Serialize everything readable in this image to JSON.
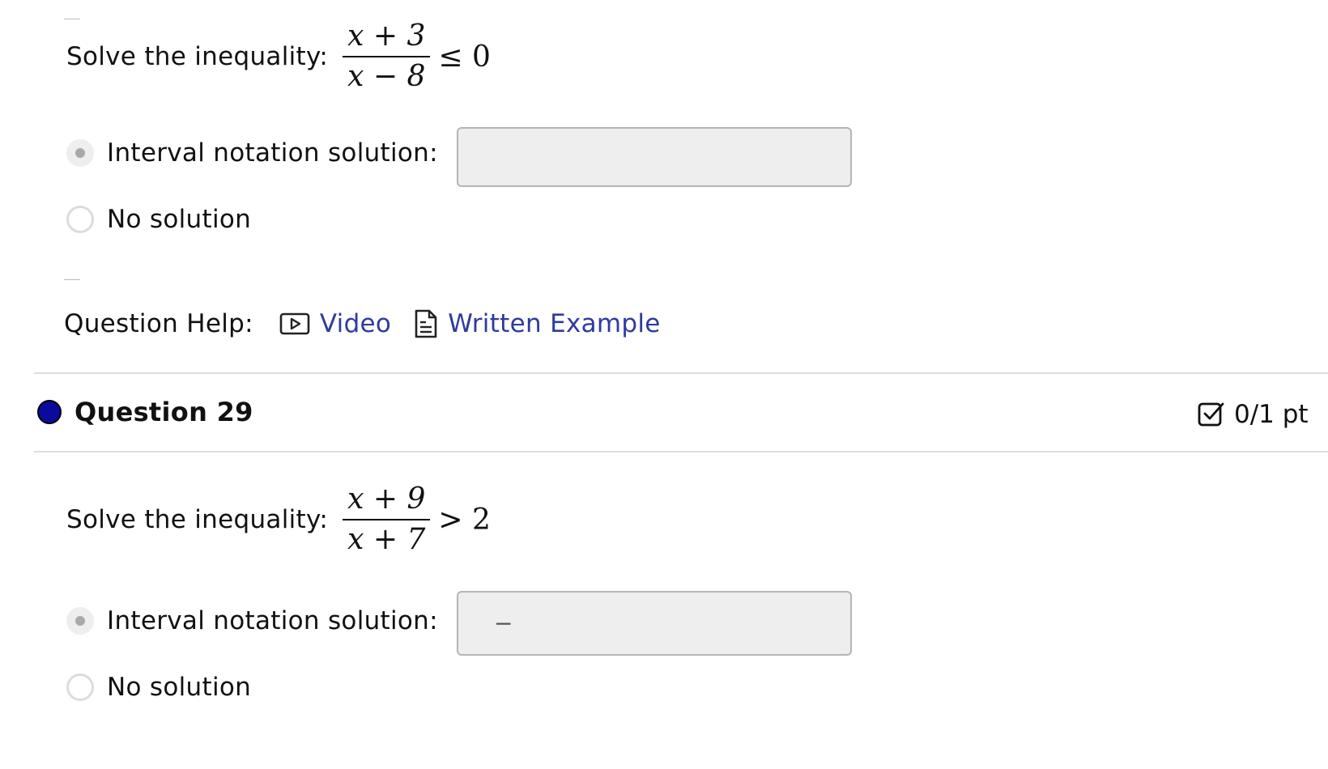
{
  "question_28": {
    "prompt": "Solve the inequality:",
    "numerator": "x + 3",
    "denominator": "x − 8",
    "relation": "≤ 0",
    "option_interval_label": "Interval notation solution:",
    "interval_value": "",
    "option_no_solution_label": "No solution",
    "selected_option": "interval"
  },
  "question_help": {
    "label": "Question Help:",
    "video_label": "Video",
    "video_icon": "video-icon",
    "written_example_label": "Written Example",
    "written_example_icon": "document-icon"
  },
  "question_29": {
    "title": "Question 29",
    "status_color": "#0a0a9e",
    "points": "0/1 pt",
    "points_icon": "checkbox-icon",
    "prompt": "Solve the inequality:",
    "numerator": "x + 9",
    "denominator": "x + 7",
    "relation": "> 2",
    "option_interval_label": "Interval notation solution:",
    "interval_value": "−",
    "option_no_solution_label": "No solution",
    "selected_option": "interval"
  },
  "colors": {
    "link": "#2f3b9e",
    "input_bg": "#eeeeee",
    "divider": "#dddddd"
  }
}
